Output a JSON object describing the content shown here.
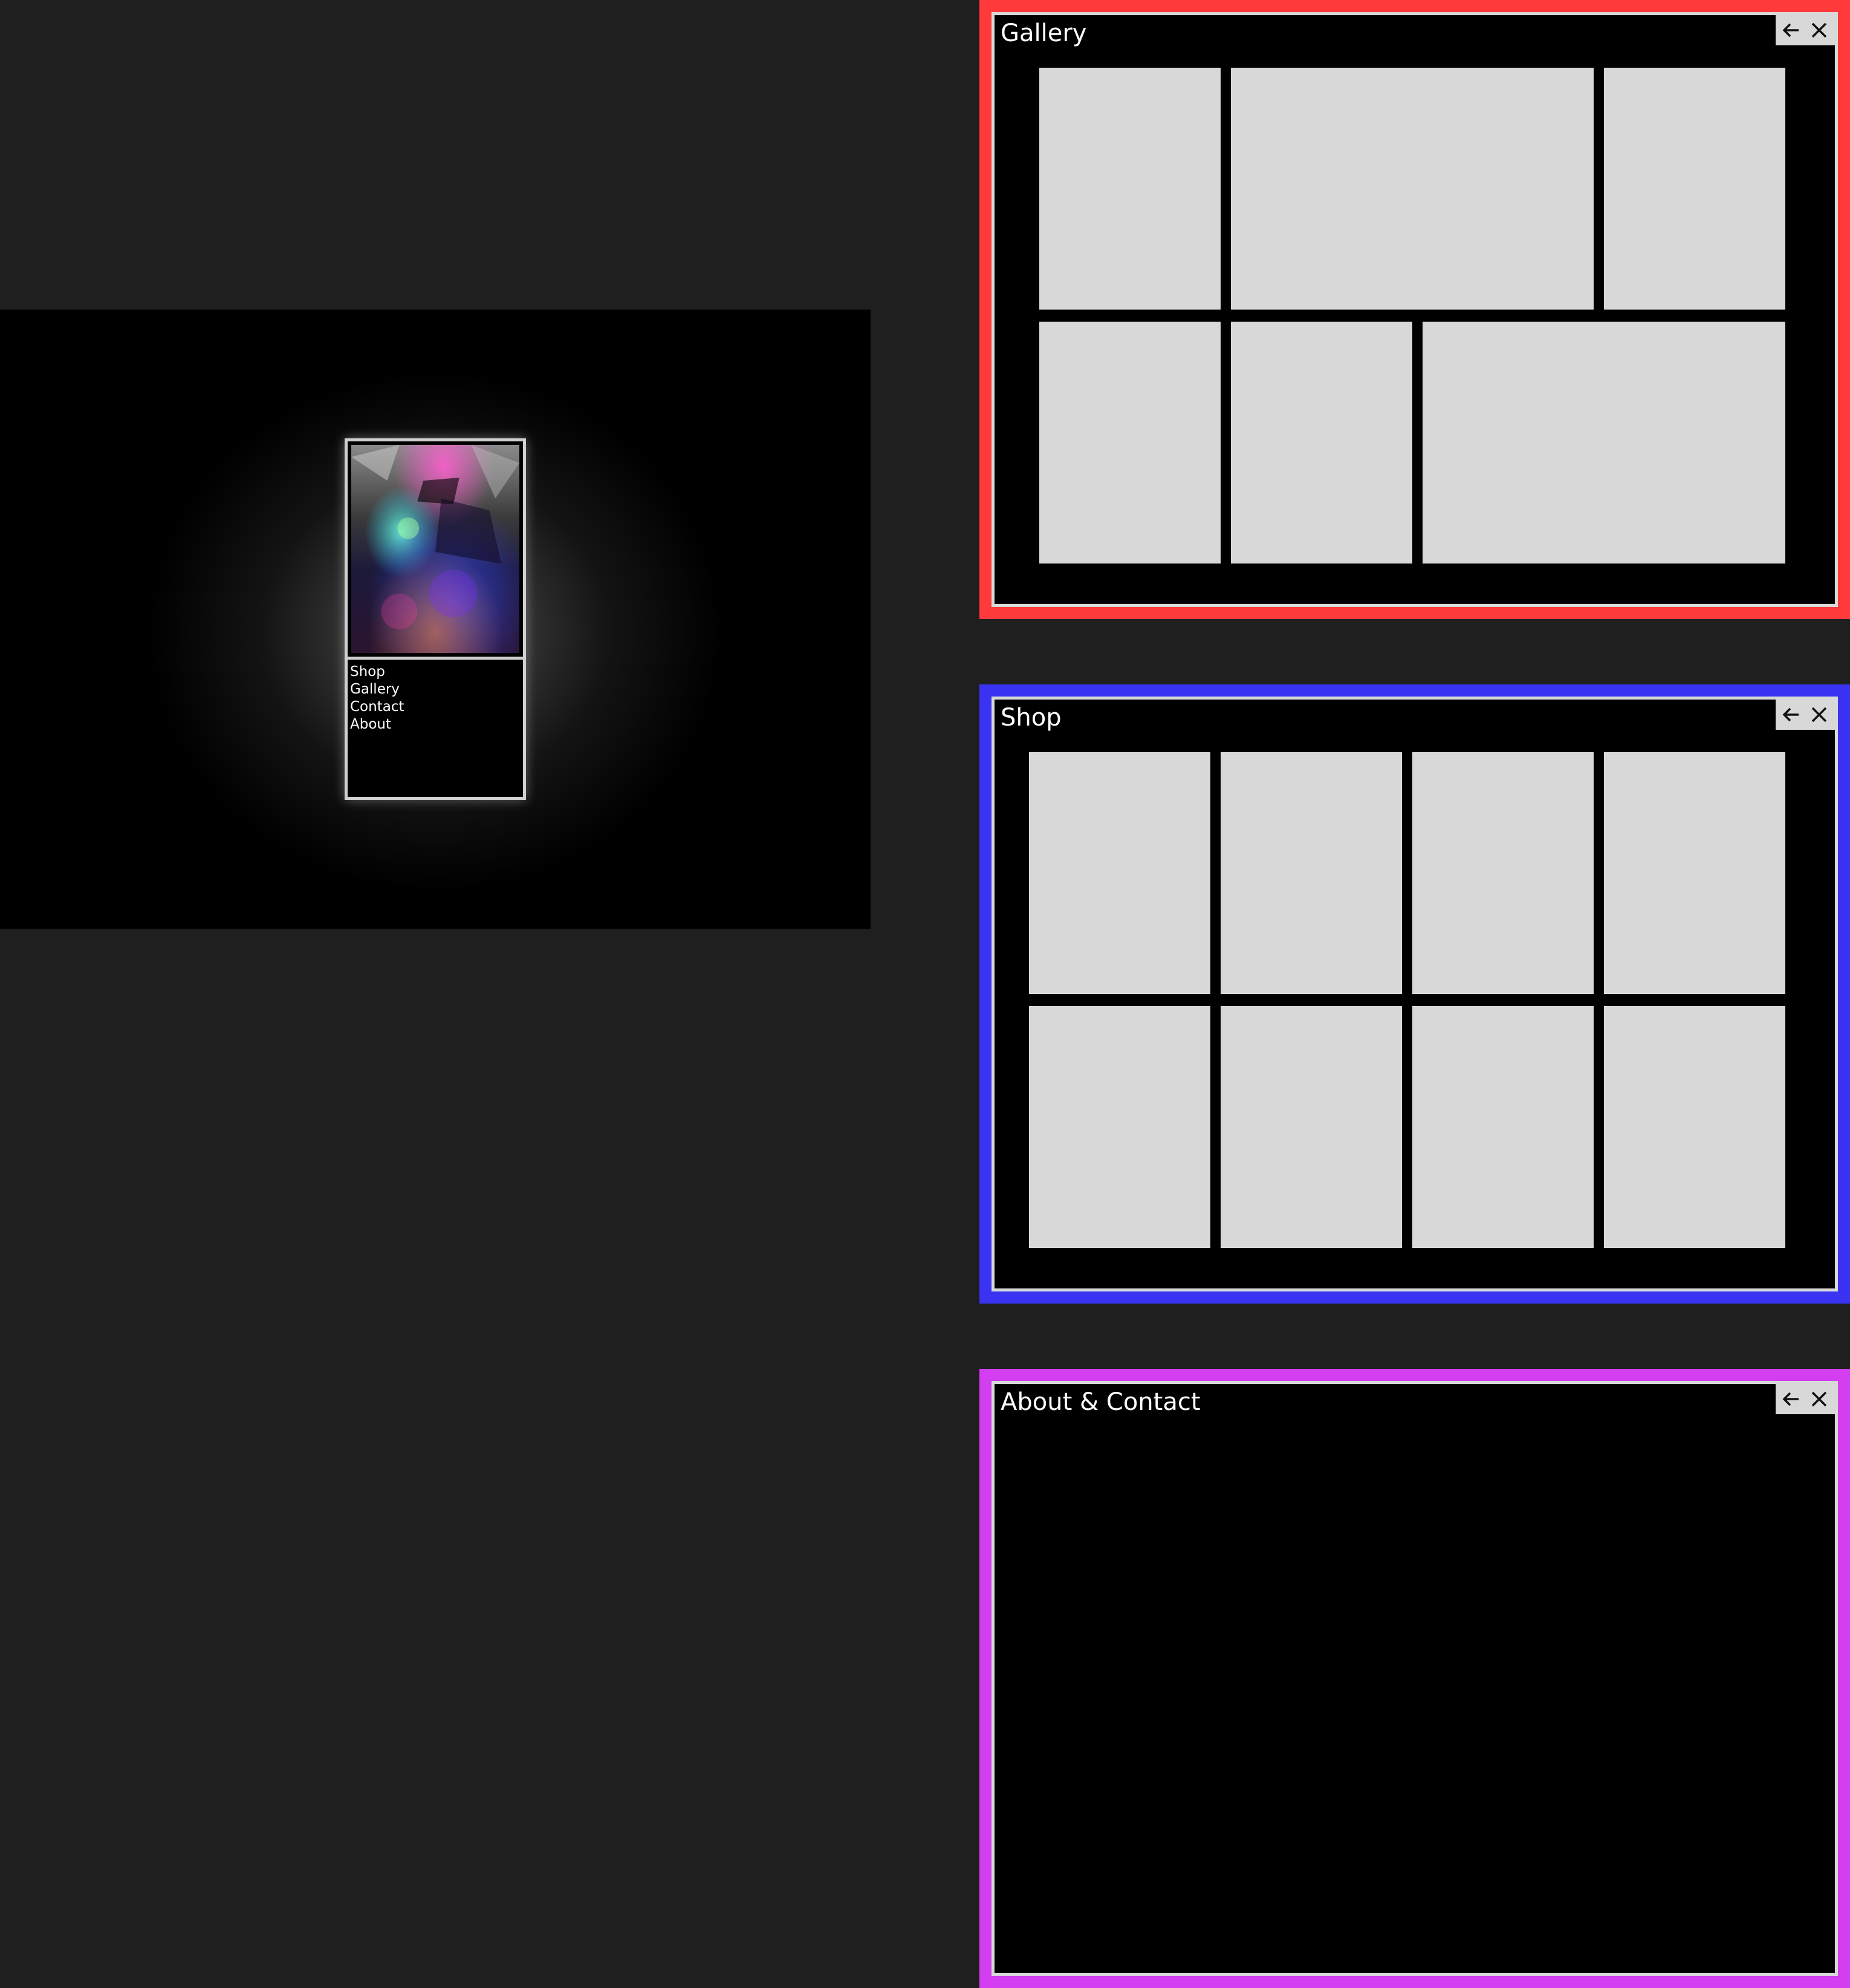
{
  "landing": {
    "menu": [
      {
        "label": "Shop"
      },
      {
        "label": "Gallery"
      },
      {
        "label": "Contact"
      },
      {
        "label": "About"
      }
    ]
  },
  "windows": {
    "gallery": {
      "title": "Gallery",
      "frame_color": "#ff3a3a",
      "controls": {
        "back_icon": "arrow-left-icon",
        "close_icon": "close-icon"
      },
      "thumbnail_count": 6
    },
    "shop": {
      "title": "Shop",
      "frame_color": "#3a34f2",
      "controls": {
        "back_icon": "arrow-left-icon",
        "close_icon": "close-icon"
      },
      "thumbnail_count": 8
    },
    "about": {
      "title": "About & Contact",
      "frame_color": "#d23ef0",
      "controls": {
        "back_icon": "arrow-left-icon",
        "close_icon": "close-icon"
      }
    }
  },
  "colors": {
    "page_background": "#1f1f1f",
    "panel_background": "#000000",
    "placeholder": "#d8d8d8"
  }
}
